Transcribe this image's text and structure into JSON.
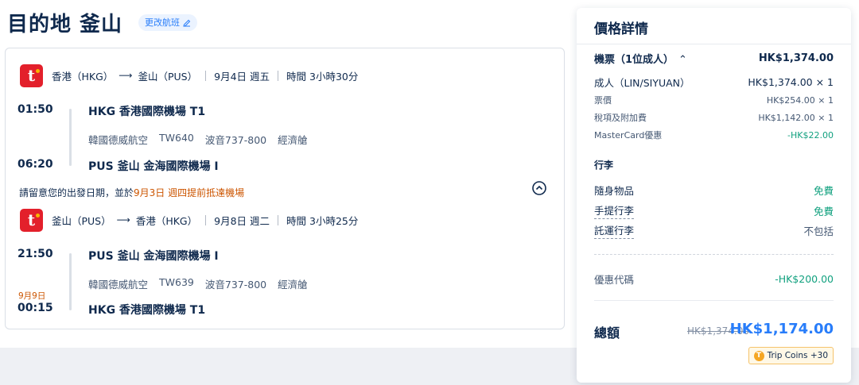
{
  "header": {
    "title": "目的地 釜山",
    "change_label": "更改航班"
  },
  "segments": [
    {
      "airline_logo_text": "t",
      "from": "香港（HKG）",
      "to": "釜山（PUS）",
      "date": "9月4日 週五",
      "duration": "時間 3小時30分",
      "dep_time": "01:50",
      "dep_airport": "HKG 香港國際機場 T1",
      "airline": "韓國德威航空",
      "flight_no": "TW640",
      "aircraft": "波音737-800",
      "cabin": "經濟艙",
      "arr_time": "06:20",
      "arr_airport": "PUS 釜山 金海國際機場 I",
      "arr_date_note": ""
    },
    {
      "airline_logo_text": "t",
      "from": "釜山（PUS）",
      "to": "香港（HKG）",
      "date": "9月8日 週二",
      "duration": "時間 3小時25分",
      "dep_time": "21:50",
      "dep_airport": "PUS 釜山 金海國際機場 I",
      "airline": "韓國德威航空",
      "flight_no": "TW639",
      "aircraft": "波音737-800",
      "cabin": "經濟艙",
      "arr_time": "00:15",
      "arr_airport": "HKG 香港國際機場 T1",
      "arr_date_note": "9月9日"
    }
  ],
  "notice": {
    "prefix": "請留意您的出發日期，並於",
    "highlight": "9月3日 週四提前抵達機場"
  },
  "price": {
    "title": "價格詳情",
    "ticket_label": "機票（1位成人）",
    "ticket_total": "HK$1,374.00",
    "adult_label": "成人（LIN/SIYUAN）",
    "adult_value": "HK$1,374.00 × 1",
    "fare_label": "票價",
    "fare_value": "HK$254.00 × 1",
    "tax_label": "稅項及附加費",
    "tax_value": "HK$1,142.00 × 1",
    "mc_label": "MasterCard優惠",
    "mc_value": "-HK$22.00",
    "baggage_title": "行李",
    "baggage": [
      {
        "label": "隨身物品",
        "value": "免費"
      },
      {
        "label": "手提行李",
        "value": "免費"
      },
      {
        "label": "託運行李",
        "value": "不包括"
      }
    ],
    "promo_label": "優惠代碼",
    "promo_value": "-HK$200.00",
    "total_label": "總額",
    "total_old": "HK$1,374.00",
    "total_new": "HK$1,174.00",
    "coins_label": "Trip Coins +30"
  },
  "colors": {
    "accent": "#287dfa",
    "brand_red": "#e3202b",
    "warning": "#cc5500",
    "success": "#12a17f"
  }
}
